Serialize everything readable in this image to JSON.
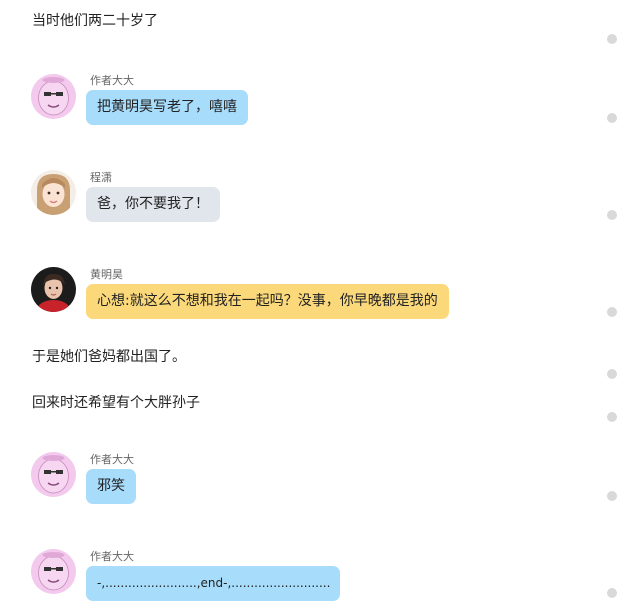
{
  "narration": [
    "当时他们两二十岁了",
    "于是她们爸妈都出国了。",
    "回来时还希望有个大胖孙子"
  ],
  "messages": [
    {
      "speaker": "作者大大",
      "text": "把黄明昊写老了，嘻嘻",
      "color": "#a8dcfb"
    },
    {
      "speaker": "程潇",
      "text": "爸，你不要我了！",
      "color": "#e1e6ec"
    },
    {
      "speaker": "黄明昊",
      "text": "心想:就这么不想和我在一起吗？没事，你早晚都是我的",
      "color": "#fbd97b"
    },
    {
      "speaker": "作者大大",
      "text": "邪笑",
      "color": "#a8dcfb"
    },
    {
      "speaker": "作者大大",
      "text": "-,........................,end-,..........................",
      "color": "#a8dcfb"
    }
  ]
}
